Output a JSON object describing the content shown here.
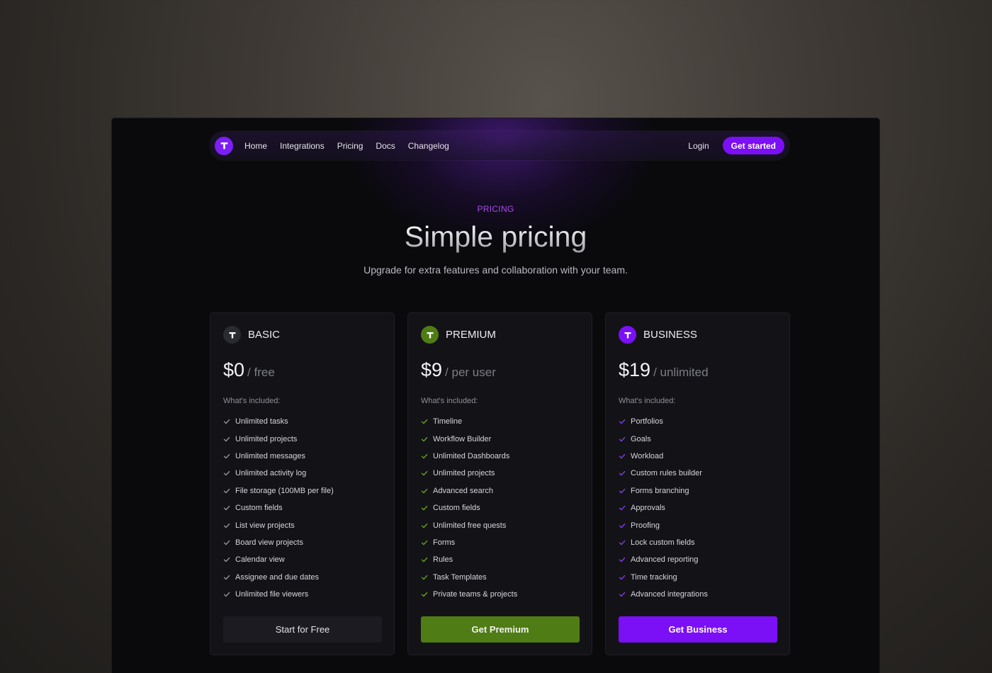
{
  "nav": {
    "logo_icon": "t-logo-icon",
    "links": [
      "Home",
      "Integrations",
      "Pricing",
      "Docs",
      "Changelog"
    ],
    "login": "Login",
    "cta": "Get started"
  },
  "hero": {
    "eyebrow": "PRICING",
    "title": "Simple pricing",
    "subtitle": "Upgrade for extra features and collaboration with your team."
  },
  "plans": [
    {
      "name": "BASIC",
      "price": "$0",
      "unit": "/ free",
      "included_label": "What's included:",
      "accent": "#2a2a31",
      "check_color": "#9a9aa3",
      "features": [
        "Unlimited tasks",
        "Unlimited projects",
        "Unlimited messages",
        "Unlimited activity log",
        "File storage (100MB per file)",
        "Custom fields",
        "List view projects",
        "Board view projects",
        "Calendar view",
        "Assignee and due dates",
        "Unlimited file viewers"
      ],
      "button": "Start for Free"
    },
    {
      "name": "PREMIUM",
      "price": "$9",
      "unit": "/ per user",
      "included_label": "What's included:",
      "accent": "#4f7c14",
      "check_color": "#6fa81e",
      "features": [
        "Timeline",
        "Workflow Builder",
        "Unlimited Dashboards",
        "Unlimited projects",
        "Advanced search",
        "Custom fields",
        "Unlimited free quests",
        "Forms",
        "Rules",
        "Task Templates",
        "Private teams & projects"
      ],
      "button": "Get Premium"
    },
    {
      "name": "BUSINESS",
      "price": "$19",
      "unit": "/ unlimited",
      "included_label": "What's included:",
      "accent": "#7b0ff5",
      "check_color": "#8a3ff0",
      "features": [
        "Portfolios",
        "Goals",
        "Workload",
        "Custom rules builder",
        "Forms branching",
        "Approvals",
        "Proofing",
        "Lock custom fields",
        "Advanced reporting",
        "Time tracking",
        "Advanced integrations"
      ],
      "button": "Get Business"
    }
  ]
}
